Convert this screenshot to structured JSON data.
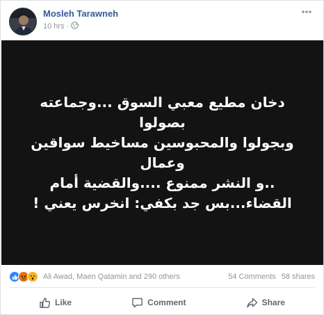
{
  "post": {
    "author": "Mosleh Tarawneh",
    "time": "10 hrs",
    "separator": "·",
    "text_lines": [
      "دخان مطيع معبي السوق ...وجماعته بصولوا",
      "وبجولوا والمحبوسين مساخيط سواقين وعمال",
      "..و النشر ممنوع ....والقضية أمام",
      "القضاء...بس جد بكفي: انخرس يعني !"
    ]
  },
  "stats": {
    "reactors": "Ali Awad, Maen Qatamin and 290 others",
    "comments": "54 Comments",
    "shares": "58 shares"
  },
  "actions": {
    "like": "Like",
    "comment": "Comment",
    "share": "Share"
  },
  "icons": {
    "options": "more-options-icon",
    "privacy": "globe-icon",
    "reaction_like": "like-reaction-icon",
    "reaction_angry": "angry-reaction-icon",
    "reaction_wow": "wow-reaction-icon"
  },
  "colors": {
    "author_link": "#365899",
    "meta_text": "#90949c",
    "media_background": "#131313",
    "like_blue": "#2d88ff",
    "angry_orange": "#e9710f",
    "wow_yellow": "#f7b125"
  }
}
